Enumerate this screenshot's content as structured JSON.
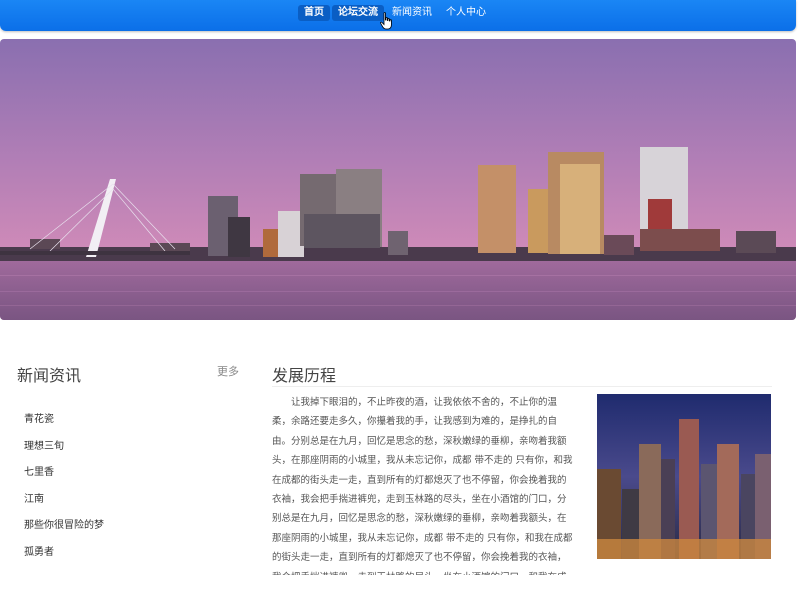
{
  "nav": {
    "items": [
      {
        "label": "首页"
      },
      {
        "label": "论坛交流"
      },
      {
        "label": "新闻资讯"
      },
      {
        "label": "个人中心"
      }
    ]
  },
  "news": {
    "title": "新闻资讯",
    "more": "更多",
    "items": [
      {
        "label": "青花瓷"
      },
      {
        "label": "理想三旬"
      },
      {
        "label": "七里香"
      },
      {
        "label": "江南"
      },
      {
        "label": "那些你很冒险的梦"
      },
      {
        "label": "孤勇者"
      }
    ]
  },
  "history": {
    "title": "发展历程",
    "body": "让我掉下眼泪的，不止昨夜的酒，让我依依不舍的，不止你的温柔，余路还要走多久，你攥着我的手，让我感到为难的，是挣扎的自由。分别总是在九月，回忆是思念的愁，深秋嫩绿的垂柳，亲吻着我额头，在那座阴雨的小城里，我从未忘记你，成都 带不走的 只有你，和我在成都的街头走一走，直到所有的灯都熄灭了也不停留，你会挽着我的衣袖，我会把手揣进裤兜，走到玉林路的尽头，坐在小酒馆的门口，分别总是在九月，回忆是思念的愁，深秋嫩绿的垂柳，亲吻着我额头，在那座阴雨的小城里，我从未忘记你，成都 带不走的 只有你，和我在成都的街头走一走，直到所有的灯都熄灭了也不停留，你会挽着我的衣袖，我会把手揣进裤兜，走到玉林路的尽头，坐在小酒馆的门口，和我在成都的街头走一走，直到所有的灯都熄灭了也不停留，和我在成都的"
  }
}
